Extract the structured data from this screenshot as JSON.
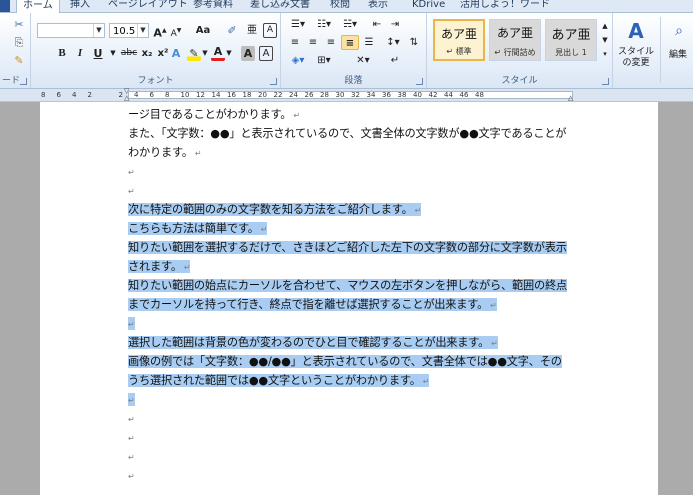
{
  "tabs": [
    "ホーム",
    "挿入",
    "ページレイアウト",
    "参考資料",
    "差し込み文書",
    "校閲",
    "表示",
    "KDrive",
    "活用しよう！ワード"
  ],
  "ribbon": {
    "font_group_label": "フォント",
    "paragraph_group_label": "段落",
    "styles_group_label": "スタイル",
    "clipboard_group_label": "ード",
    "font_name": "",
    "font_size": "10.5",
    "grow_font": "A",
    "shrink_font": "A",
    "change_case": "Aa",
    "bold": "B",
    "italic": "I",
    "underline": "U",
    "strike": "abc",
    "subscript": "x₂",
    "superscript": "x²",
    "font_color": "A",
    "char_shading": "A",
    "char_border": "A",
    "styles": [
      {
        "sample": "あア亜",
        "name": "↵ 標準"
      },
      {
        "sample": "あア亜",
        "name": "↵ 行間詰め"
      },
      {
        "sample": "あア亜",
        "name": "見出し 1"
      }
    ],
    "change_styles": "スタイルの変更",
    "editing": "編集"
  },
  "ruler_numbers": [
    "8",
    "6",
    "4",
    "2",
    "",
    "2",
    "4",
    "6",
    "8",
    "10",
    "12",
    "14",
    "16",
    "18",
    "20",
    "22",
    "24",
    "26",
    "28",
    "30",
    "32",
    "34",
    "36",
    "38",
    "40",
    "42",
    "44",
    "46",
    "48"
  ],
  "paragraph_mark": "↵",
  "document": {
    "lines": [
      {
        "text": "ージ目であることがわかります。",
        "hl": false
      },
      {
        "text": "また、「文字数：●●」と表示されているので、文書全体の文字数が●●文字であることが",
        "hl": false,
        "nomark": true
      },
      {
        "text": "わかります。",
        "hl": false
      },
      {
        "text": "",
        "hl": false
      },
      {
        "text": "",
        "hl": false
      },
      {
        "text": "次に特定の範囲のみの文字数を知る方法をご紹介します。",
        "hl": true
      },
      {
        "text": "こちらも方法は簡単です。",
        "hl": true
      },
      {
        "text": "知りたい範囲を選択するだけで、さきほどご紹介した左下の文字数の部分に文字数が表示",
        "hl": true,
        "nomark": true
      },
      {
        "text": "されます。",
        "hl": true
      },
      {
        "text": "知りたい範囲の始点にカーソルを合わせて、マウスの左ボタンを押しながら、範囲の終点",
        "hl": true,
        "nomark": true
      },
      {
        "text": "までカーソルを持って行き、終点で指を離せば選択することが出来ます。",
        "hl": true
      },
      {
        "text": "",
        "hl": true
      },
      {
        "text": "選択した範囲は背景の色が変わるのでひと目で確認することが出来ます。",
        "hl": true
      },
      {
        "text": "画像の例では「文字数：●●/●●」と表示されているので、文書全体では●●文字、その",
        "hl": true,
        "nomark": true
      },
      {
        "text": "うち選択された範囲では●●文字ということがわかります。",
        "hl": true
      },
      {
        "text": "",
        "hl": true
      },
      {
        "text": "",
        "hl": false
      },
      {
        "text": "",
        "hl": false
      },
      {
        "text": "",
        "hl": false
      },
      {
        "text": "",
        "hl": false
      }
    ]
  }
}
